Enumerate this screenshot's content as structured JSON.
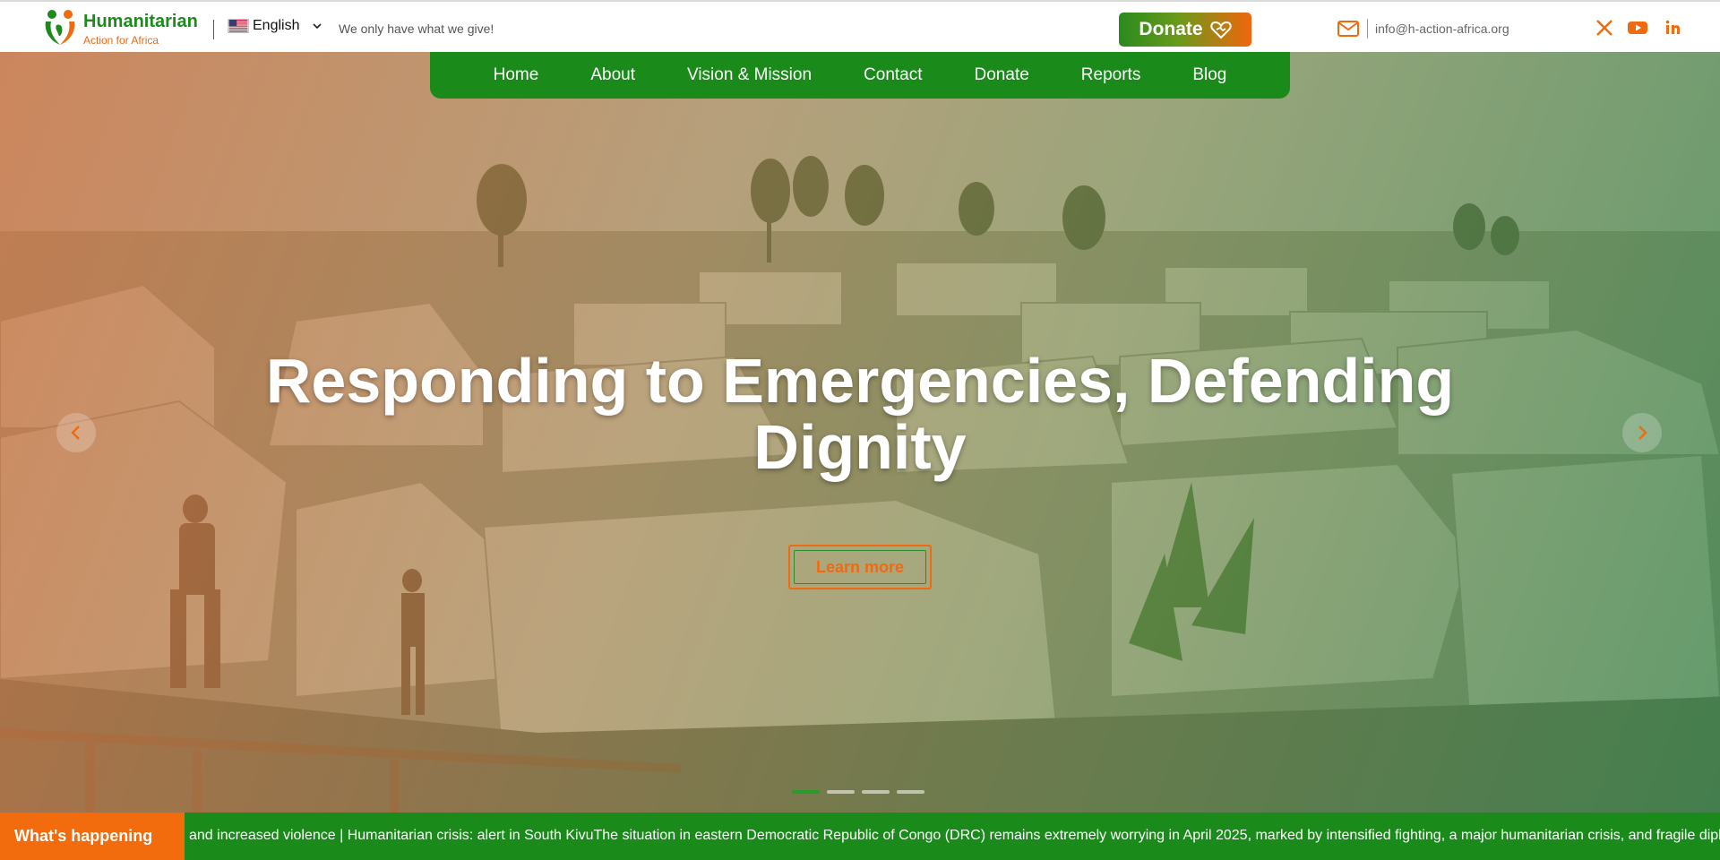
{
  "header": {
    "brand_name": "Humanitarian",
    "brand_sub": "Action for Africa",
    "language": "English",
    "tagline": "We only have what we give!",
    "donate_label": "Donate",
    "email": "info@h-action-africa.org",
    "social": [
      "x-icon",
      "youtube-icon",
      "linkedin-icon"
    ]
  },
  "nav": {
    "items": [
      "Home",
      "About",
      "Vision & Mission",
      "Contact",
      "Donate",
      "Reports",
      "Blog"
    ]
  },
  "hero": {
    "title": "Responding to Emergencies, Defending Dignity",
    "cta": "Learn more",
    "slide_count": 4,
    "active_slide": 1
  },
  "ticker": {
    "label": "What's happening",
    "text": "and increased violence | Humanitarian crisis: alert in South KivuThe situation in eastern Democratic Republic of Congo (DRC) remains extremely worrying in April 2025, marked by intensified fighting, a major humanitarian crisis, and fragile diplomatic efforts"
  },
  "colors": {
    "brand_green": "#1a8a1a",
    "brand_orange": "#f26b0c"
  }
}
